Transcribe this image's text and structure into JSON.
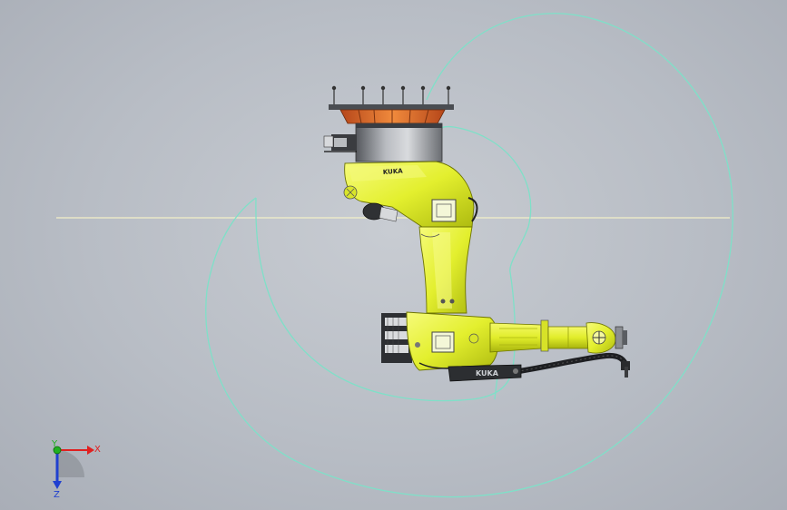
{
  "viewport": {
    "background_center": "#c8ccd2",
    "background_edge": "#a9aeb7"
  },
  "robot": {
    "arm_brand_label": "KUKA",
    "forearm_brand_label": "KUKA",
    "body_color": "#e6f23a",
    "base_flange_color": "#e8702a",
    "base_cylinder_color": "#8a8d92",
    "cable_color": "#222222"
  },
  "work_envelope": {
    "stroke_color": "#7fe0c8",
    "reference_line_color": "#f3f0c8"
  },
  "triad": {
    "x_label": "X",
    "y_label": "Y",
    "z_label": "Z",
    "x_color": "#e02020",
    "y_color": "#20b020",
    "z_color": "#2040d0"
  }
}
